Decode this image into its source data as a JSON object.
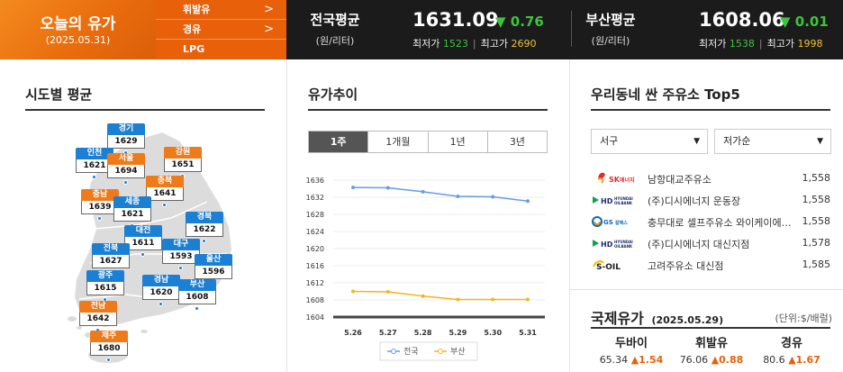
{
  "header": {
    "title": "오늘의 유가",
    "date": "(2025.05.31)",
    "fuel_menu": [
      "휘발유",
      "경유",
      "LPG"
    ],
    "national": {
      "name": "전국평균",
      "unit": "(원/리터)",
      "price": "1631.09",
      "change": "▼ 0.76",
      "min_label": "최저가",
      "min": "1523",
      "max_label": "최고가",
      "max": "2690"
    },
    "busan": {
      "name": "부산평균",
      "unit": "(원/리터)",
      "price": "1608.06",
      "change": "▼ 0.01",
      "min_label": "최저가",
      "min": "1538",
      "max_label": "최고가",
      "max": "1998"
    }
  },
  "regions": {
    "title": "시도별 평균",
    "items": [
      {
        "id": "gyeonggi",
        "name": "경기",
        "value": "1629",
        "color": "blue"
      },
      {
        "id": "incheon",
        "name": "인천",
        "value": "1621",
        "color": "blue"
      },
      {
        "id": "seoul",
        "name": "서울",
        "value": "1694",
        "color": "orange"
      },
      {
        "id": "gangwon",
        "name": "강원",
        "value": "1651",
        "color": "orange"
      },
      {
        "id": "chungbuk",
        "name": "충북",
        "value": "1641",
        "color": "orange"
      },
      {
        "id": "chungnam",
        "name": "충남",
        "value": "1639",
        "color": "orange"
      },
      {
        "id": "sejong",
        "name": "세종",
        "value": "1621",
        "color": "blue"
      },
      {
        "id": "daejeon",
        "name": "대전",
        "value": "1611",
        "color": "blue"
      },
      {
        "id": "gyeongbuk",
        "name": "경북",
        "value": "1622",
        "color": "blue"
      },
      {
        "id": "jeonbuk",
        "name": "전북",
        "value": "1627",
        "color": "blue"
      },
      {
        "id": "daegu",
        "name": "대구",
        "value": "1593",
        "color": "blue"
      },
      {
        "id": "ulsan",
        "name": "울산",
        "value": "1596",
        "color": "blue"
      },
      {
        "id": "gwangju",
        "name": "광주",
        "value": "1615",
        "color": "blue"
      },
      {
        "id": "gyeongnam",
        "name": "경남",
        "value": "1620",
        "color": "blue"
      },
      {
        "id": "busan",
        "name": "부산",
        "value": "1608",
        "color": "blue"
      },
      {
        "id": "jeonnam",
        "name": "전남",
        "value": "1642",
        "color": "orange"
      },
      {
        "id": "jeju",
        "name": "제주",
        "value": "1680",
        "color": "orange"
      }
    ]
  },
  "trend": {
    "title": "유가추이",
    "tabs": [
      "1주",
      "1개월",
      "1년",
      "3년"
    ],
    "active_tab": "1주"
  },
  "chart_data": {
    "type": "line",
    "x": [
      "5.26",
      "5.27",
      "5.28",
      "5.29",
      "5.30",
      "5.31"
    ],
    "series": [
      {
        "name": "전국",
        "color": "#6a9be6",
        "values": [
          1634.3,
          1634.2,
          1633.3,
          1632.2,
          1632.1,
          1631.1
        ]
      },
      {
        "name": "부산",
        "color": "#f2b520",
        "values": [
          1610.0,
          1609.9,
          1608.9,
          1608.1,
          1608.1,
          1608.1
        ]
      }
    ],
    "yticks": [
      1636,
      1632,
      1628,
      1624,
      1620,
      1616,
      1612,
      1608,
      1604
    ],
    "ylim": [
      1604,
      1636
    ],
    "grid": true,
    "legend": "bottom"
  },
  "stations": {
    "title": "우리동네 싼 주유소 Top5",
    "district_select": "서구",
    "sort_select": "저가순",
    "items": [
      {
        "brand": "SK에너지",
        "logo_icon": "sk-energy-logo-icon",
        "name": "남항대교주유소",
        "price": "1,558"
      },
      {
        "brand": "HD현대오일뱅크",
        "logo_icon": "hd-hyundai-oilbank-logo-icon",
        "name": "(주)디시에너지 운동장",
        "price": "1,558"
      },
      {
        "brand": "GS칼텍스",
        "logo_icon": "gs-caltex-logo-icon",
        "name": "충무대로 셀프주유소 와이케이에…",
        "price": "1,558"
      },
      {
        "brand": "HD현대오일뱅크",
        "logo_icon": "hd-hyundai-oilbank-logo-icon",
        "name": "(주)디시에너지 대신지점",
        "price": "1,578"
      },
      {
        "brand": "S-OIL",
        "logo_icon": "s-oil-logo-icon",
        "name": "고려주유소 대신점",
        "price": "1,585"
      }
    ]
  },
  "international": {
    "title": "국제유가",
    "date": "(2025.05.29)",
    "unit": "(단위:$/배럴)",
    "items": [
      {
        "name": "두바이",
        "value": "65.34",
        "change": "▲1.54"
      },
      {
        "name": "휘발유",
        "value": "76.06",
        "change": "▲0.88"
      },
      {
        "name": "경유",
        "value": "80.6",
        "change": "▲1.67"
      }
    ]
  }
}
